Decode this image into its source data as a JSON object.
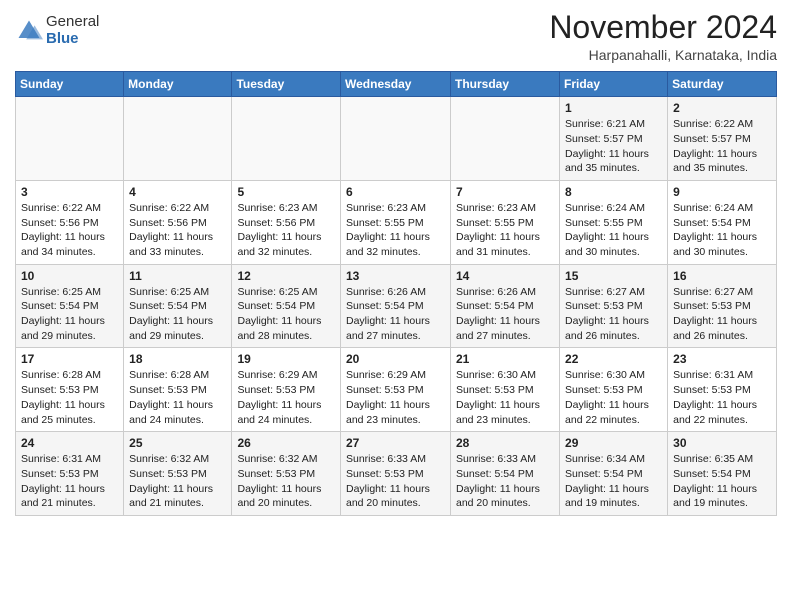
{
  "header": {
    "logo_general": "General",
    "logo_blue": "Blue",
    "month_title": "November 2024",
    "location": "Harpanahalli, Karnataka, India"
  },
  "weekdays": [
    "Sunday",
    "Monday",
    "Tuesday",
    "Wednesday",
    "Thursday",
    "Friday",
    "Saturday"
  ],
  "weeks": [
    [
      {
        "day": "",
        "info": ""
      },
      {
        "day": "",
        "info": ""
      },
      {
        "day": "",
        "info": ""
      },
      {
        "day": "",
        "info": ""
      },
      {
        "day": "",
        "info": ""
      },
      {
        "day": "1",
        "info": "Sunrise: 6:21 AM\nSunset: 5:57 PM\nDaylight: 11 hours\nand 35 minutes."
      },
      {
        "day": "2",
        "info": "Sunrise: 6:22 AM\nSunset: 5:57 PM\nDaylight: 11 hours\nand 35 minutes."
      }
    ],
    [
      {
        "day": "3",
        "info": "Sunrise: 6:22 AM\nSunset: 5:56 PM\nDaylight: 11 hours\nand 34 minutes."
      },
      {
        "day": "4",
        "info": "Sunrise: 6:22 AM\nSunset: 5:56 PM\nDaylight: 11 hours\nand 33 minutes."
      },
      {
        "day": "5",
        "info": "Sunrise: 6:23 AM\nSunset: 5:56 PM\nDaylight: 11 hours\nand 32 minutes."
      },
      {
        "day": "6",
        "info": "Sunrise: 6:23 AM\nSunset: 5:55 PM\nDaylight: 11 hours\nand 32 minutes."
      },
      {
        "day": "7",
        "info": "Sunrise: 6:23 AM\nSunset: 5:55 PM\nDaylight: 11 hours\nand 31 minutes."
      },
      {
        "day": "8",
        "info": "Sunrise: 6:24 AM\nSunset: 5:55 PM\nDaylight: 11 hours\nand 30 minutes."
      },
      {
        "day": "9",
        "info": "Sunrise: 6:24 AM\nSunset: 5:54 PM\nDaylight: 11 hours\nand 30 minutes."
      }
    ],
    [
      {
        "day": "10",
        "info": "Sunrise: 6:25 AM\nSunset: 5:54 PM\nDaylight: 11 hours\nand 29 minutes."
      },
      {
        "day": "11",
        "info": "Sunrise: 6:25 AM\nSunset: 5:54 PM\nDaylight: 11 hours\nand 29 minutes."
      },
      {
        "day": "12",
        "info": "Sunrise: 6:25 AM\nSunset: 5:54 PM\nDaylight: 11 hours\nand 28 minutes."
      },
      {
        "day": "13",
        "info": "Sunrise: 6:26 AM\nSunset: 5:54 PM\nDaylight: 11 hours\nand 27 minutes."
      },
      {
        "day": "14",
        "info": "Sunrise: 6:26 AM\nSunset: 5:54 PM\nDaylight: 11 hours\nand 27 minutes."
      },
      {
        "day": "15",
        "info": "Sunrise: 6:27 AM\nSunset: 5:53 PM\nDaylight: 11 hours\nand 26 minutes."
      },
      {
        "day": "16",
        "info": "Sunrise: 6:27 AM\nSunset: 5:53 PM\nDaylight: 11 hours\nand 26 minutes."
      }
    ],
    [
      {
        "day": "17",
        "info": "Sunrise: 6:28 AM\nSunset: 5:53 PM\nDaylight: 11 hours\nand 25 minutes."
      },
      {
        "day": "18",
        "info": "Sunrise: 6:28 AM\nSunset: 5:53 PM\nDaylight: 11 hours\nand 24 minutes."
      },
      {
        "day": "19",
        "info": "Sunrise: 6:29 AM\nSunset: 5:53 PM\nDaylight: 11 hours\nand 24 minutes."
      },
      {
        "day": "20",
        "info": "Sunrise: 6:29 AM\nSunset: 5:53 PM\nDaylight: 11 hours\nand 23 minutes."
      },
      {
        "day": "21",
        "info": "Sunrise: 6:30 AM\nSunset: 5:53 PM\nDaylight: 11 hours\nand 23 minutes."
      },
      {
        "day": "22",
        "info": "Sunrise: 6:30 AM\nSunset: 5:53 PM\nDaylight: 11 hours\nand 22 minutes."
      },
      {
        "day": "23",
        "info": "Sunrise: 6:31 AM\nSunset: 5:53 PM\nDaylight: 11 hours\nand 22 minutes."
      }
    ],
    [
      {
        "day": "24",
        "info": "Sunrise: 6:31 AM\nSunset: 5:53 PM\nDaylight: 11 hours\nand 21 minutes."
      },
      {
        "day": "25",
        "info": "Sunrise: 6:32 AM\nSunset: 5:53 PM\nDaylight: 11 hours\nand 21 minutes."
      },
      {
        "day": "26",
        "info": "Sunrise: 6:32 AM\nSunset: 5:53 PM\nDaylight: 11 hours\nand 20 minutes."
      },
      {
        "day": "27",
        "info": "Sunrise: 6:33 AM\nSunset: 5:53 PM\nDaylight: 11 hours\nand 20 minutes."
      },
      {
        "day": "28",
        "info": "Sunrise: 6:33 AM\nSunset: 5:54 PM\nDaylight: 11 hours\nand 20 minutes."
      },
      {
        "day": "29",
        "info": "Sunrise: 6:34 AM\nSunset: 5:54 PM\nDaylight: 11 hours\nand 19 minutes."
      },
      {
        "day": "30",
        "info": "Sunrise: 6:35 AM\nSunset: 5:54 PM\nDaylight: 11 hours\nand 19 minutes."
      }
    ]
  ]
}
